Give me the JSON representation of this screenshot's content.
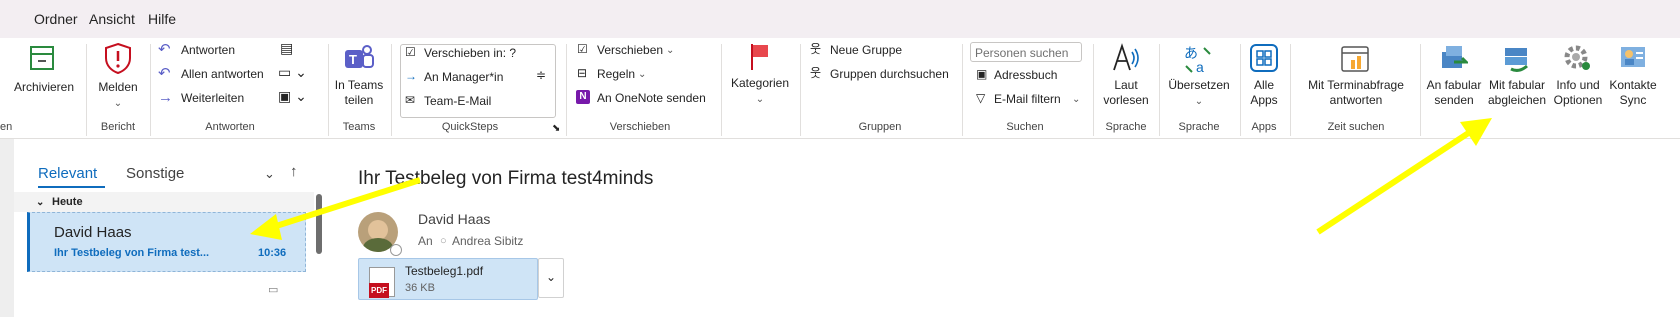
{
  "menu": [
    "Ordner",
    "Ansicht",
    "Hilfe"
  ],
  "ribbon": {
    "archivieren": "Archivieren",
    "melden": "Melden",
    "bericht_group": "Bericht",
    "antworten": "Antworten",
    "allen_antworten": "Allen antworten",
    "weiterleiten": "Weiterleiten",
    "antworten_group": "Antworten",
    "in_teams_teilen_1": "In Teams",
    "in_teams_teilen_2": "teilen",
    "teams_group": "Teams",
    "qs_verschieben": "Verschieben in: ?",
    "qs_manager": "An Manager*in",
    "qs_team_email": "Team-E-Mail",
    "quicksteps_group": "QuickSteps",
    "verschieben": "Verschieben",
    "regeln": "Regeln",
    "onenote": "An OneNote senden",
    "verschieben_group": "Verschieben",
    "kategorien": "Kategorien",
    "neue_gruppe": "Neue Gruppe",
    "gruppen_durchsuchen": "Gruppen durchsuchen",
    "gruppen_group": "Gruppen",
    "personen_suchen": "Personen suchen",
    "adressbuch": "Adressbuch",
    "email_filtern": "E-Mail filtern",
    "suchen_group": "Suchen",
    "laut_vorlesen_1": "Laut",
    "laut_vorlesen_2": "vorlesen",
    "sprache_group1": "Sprache",
    "uebersetzen": "Übersetzen",
    "sprache_group2": "Sprache",
    "alle_apps_1": "Alle",
    "alle_apps_2": "Apps",
    "apps_group": "Apps",
    "terminabfrage_1": "Mit Terminabfrage",
    "terminabfrage_2": "antworten",
    "zeit_suchen_group": "Zeit suchen",
    "fabular_senden_1": "An fabular",
    "fabular_senden_2": "senden",
    "fabular_abgleichen_1": "Mit fabular",
    "fabular_abgleichen_2": "abgleichen",
    "info_optionen_1": "Info und",
    "info_optionen_2": "Optionen",
    "kontakte_sync_1": "Kontakte",
    "kontakte_sync_2": "Sync",
    "left_cut_group": "en"
  },
  "mail_list": {
    "tab_relevant": "Relevant",
    "tab_sonstige": "Sonstige",
    "heute": "Heute",
    "item_sender": "David Haas",
    "item_subject": "Ihr Testbeleg von Firma test...",
    "item_time": "10:36"
  },
  "reading": {
    "subject": "Ihr Testbeleg von Firma test4minds",
    "sender": "David Haas",
    "to_label": "An",
    "to_name": "Andrea Sibitz",
    "attachment_name": "Testbeleg1.pdf",
    "attachment_size": "36 KB",
    "attachment_type": "PDF"
  },
  "colors": {
    "accent": "#0f6cbd",
    "arrow": "#ffff00",
    "selected": "#cfe4f6"
  }
}
